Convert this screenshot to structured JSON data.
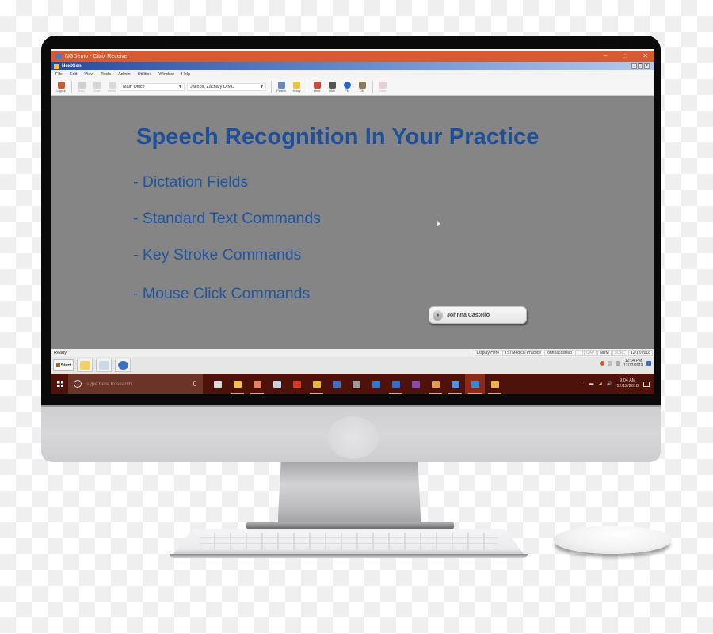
{
  "citrix": {
    "window_title": "NGDemo - Citrix Receiver",
    "controls": [
      "minimize-icon",
      "maximize-icon",
      "close-icon"
    ]
  },
  "app": {
    "title": "NextGen",
    "menu": [
      "File",
      "Edit",
      "View",
      "Tools",
      "Admin",
      "Utilities",
      "Window",
      "Help"
    ],
    "toolbar": {
      "left_buttons": [
        {
          "label": "Logout",
          "icon": "logout-icon",
          "enabled": true
        },
        {
          "label": "Save",
          "icon": "save-icon",
          "enabled": false
        },
        {
          "label": "Clear",
          "icon": "clear-icon",
          "enabled": false
        },
        {
          "label": "Delete",
          "icon": "delete-icon",
          "enabled": false
        }
      ],
      "location_select": "Main Office",
      "provider_select": "Jacobs, Zachary D MD",
      "right_buttons": [
        {
          "label": "Patient",
          "icon": "patient-icon",
          "enabled": true
        },
        {
          "label": "History",
          "icon": "history-icon",
          "enabled": true
        },
        {
          "label": "Inbox",
          "icon": "inbox-icon",
          "enabled": true
        },
        {
          "label": "PAQ",
          "icon": "paq-icon",
          "enabled": true
        },
        {
          "label": "PM",
          "icon": "pm-icon",
          "enabled": true
        },
        {
          "label": "DM",
          "icon": "dm-icon",
          "enabled": true
        },
        {
          "label": "Close",
          "icon": "close-doc-icon",
          "enabled": false
        }
      ]
    },
    "status": {
      "left": "Ready",
      "panels": [
        "Display Here",
        "TSI Medical Practice",
        "johnnacastello",
        "",
        "CAP",
        "NUM",
        "SCRL",
        "12/12/2018"
      ]
    }
  },
  "slide": {
    "title": "Speech Recognition In Your Practice",
    "bullets": [
      "- Dictation Fields",
      "- Standard Text Commands",
      "- Key Stroke Commands",
      "- Mouse Click Commands"
    ]
  },
  "dictation_widget": {
    "user": "Johnna Castello",
    "icon": "microphone-icon"
  },
  "inner_taskbar": {
    "start_label": "Start",
    "apps": [
      "folder-icon",
      "ie-history-icon",
      "globe-icon"
    ],
    "clock_time": "12:04 PM",
    "clock_date": "12/12/2018"
  },
  "win10_taskbar": {
    "search_placeholder": "Type here to search",
    "apps": [
      {
        "icon": "task-view-icon",
        "color": "#d9d9d9",
        "running": false
      },
      {
        "icon": "file-explorer-icon",
        "color": "#f0c24b",
        "running": true
      },
      {
        "icon": "snagit-icon",
        "color": "#e58262",
        "running": true
      },
      {
        "icon": "network-icon",
        "color": "#c8d2e0",
        "running": false
      },
      {
        "icon": "acrobat-icon",
        "color": "#d63a22",
        "running": false
      },
      {
        "icon": "chrome-icon",
        "color": "#e8b43a",
        "running": true
      },
      {
        "icon": "word-icon",
        "color": "#3e6fc4",
        "running": false
      },
      {
        "icon": "excel-icon",
        "color": "#9a9a9a",
        "running": false
      },
      {
        "icon": "outlook-icon",
        "color": "#2f78cf",
        "running": false
      },
      {
        "icon": "edge-icon",
        "color": "#2f6fd0",
        "running": true
      },
      {
        "icon": "onenote-icon",
        "color": "#8a4aa8",
        "running": false
      },
      {
        "icon": "settings-app-icon",
        "color": "#e39a4c",
        "running": true
      },
      {
        "icon": "store-icon",
        "color": "#5a90d8",
        "running": true
      },
      {
        "icon": "citrix-icon",
        "color": "#3d86d6",
        "running": true,
        "active": true
      },
      {
        "icon": "paint-icon",
        "color": "#efb24a",
        "running": true
      }
    ],
    "clock_time": "9:04 AM",
    "clock_date": "12/12/2018"
  }
}
